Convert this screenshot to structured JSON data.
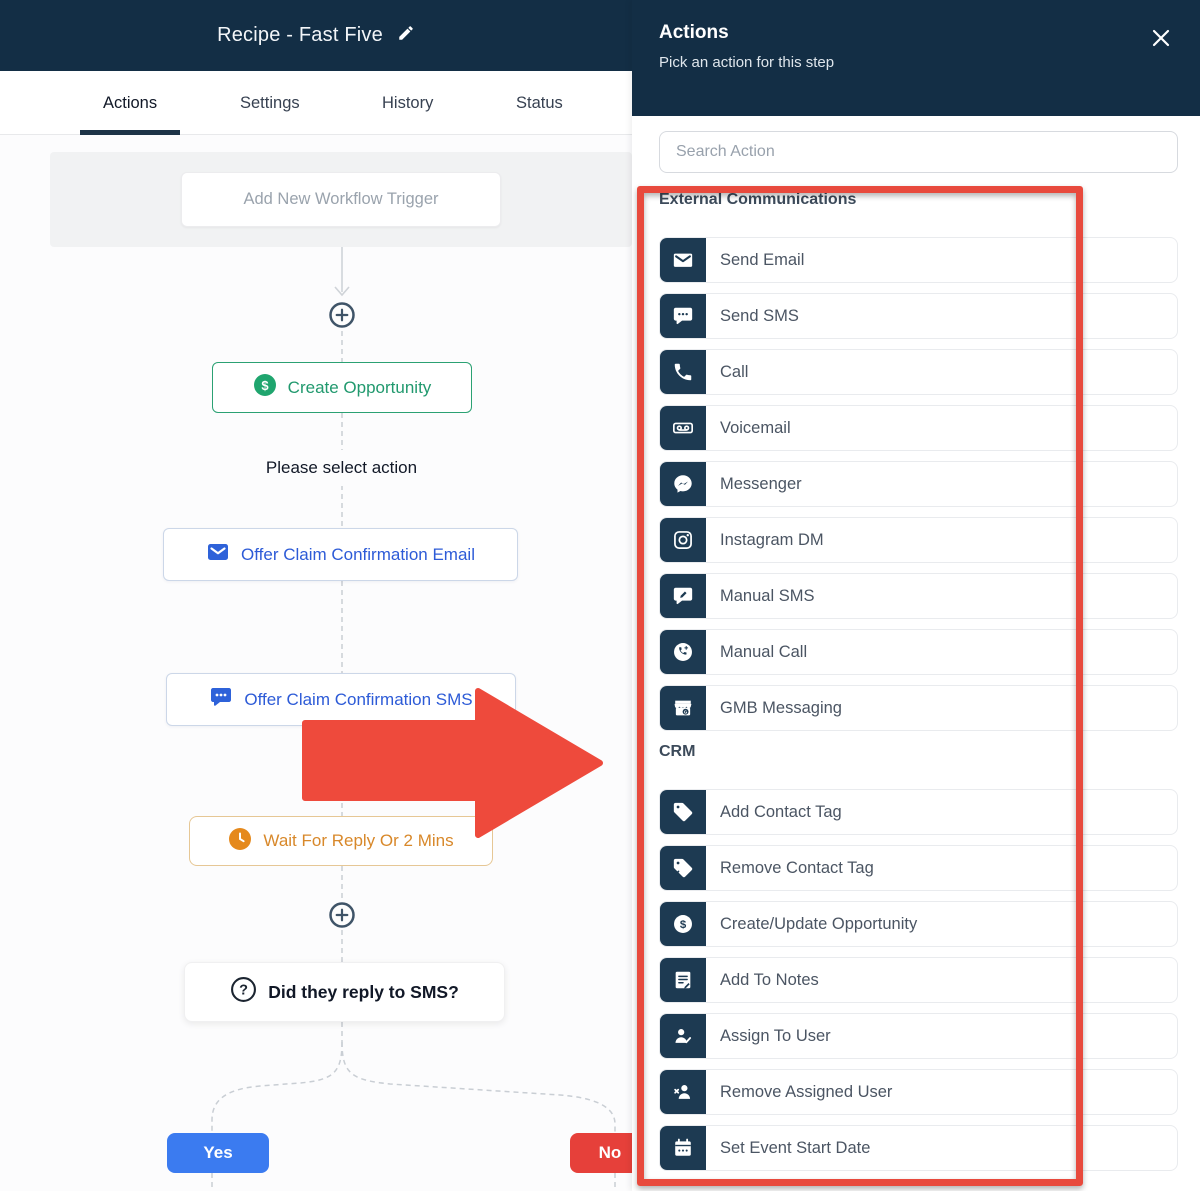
{
  "header": {
    "title": "Recipe - Fast Five",
    "edit_icon": "edit-pencil-icon"
  },
  "tabs": [
    {
      "label": "Actions",
      "active": true
    },
    {
      "label": "Settings",
      "active": false
    },
    {
      "label": "History",
      "active": false
    },
    {
      "label": "Status",
      "active": false
    }
  ],
  "canvas": {
    "trigger_label": "Add New Workflow Trigger",
    "create_opportunity_label": "Create Opportunity",
    "please_select_label": "Please select action",
    "email_action_label": "Offer Claim Confirmation Email",
    "sms_action_label": "Offer Claim Confirmation SMS",
    "wait_label": "Wait For Reply Or 2 Mins",
    "question_label": "Did they reply to SMS?",
    "branch_yes": "Yes",
    "branch_no": "No",
    "plus_icon": "plus-icon",
    "node_icons": [
      "opportunity-dollar-icon",
      "email-icon",
      "sms-icon",
      "clock-icon",
      "question-icon"
    ]
  },
  "panel": {
    "title": "Actions",
    "subtitle": "Pick an action for this step",
    "close_icon": "close-icon",
    "search_placeholder": "Search Action",
    "sections": [
      {
        "title": "External Communications",
        "items": [
          {
            "icon": "send-email-icon",
            "label": "Send Email"
          },
          {
            "icon": "send-sms-icon",
            "label": "Send SMS"
          },
          {
            "icon": "call-icon",
            "label": "Call"
          },
          {
            "icon": "voicemail-icon",
            "label": "Voicemail"
          },
          {
            "icon": "messenger-icon",
            "label": "Messenger"
          },
          {
            "icon": "instagram-dm-icon",
            "label": "Instagram DM"
          },
          {
            "icon": "manual-sms-icon",
            "label": "Manual SMS"
          },
          {
            "icon": "manual-call-icon",
            "label": "Manual Call"
          },
          {
            "icon": "gmb-messaging-icon",
            "label": "GMB Messaging"
          }
        ]
      },
      {
        "title": "CRM",
        "items": [
          {
            "icon": "add-contact-tag-icon",
            "label": "Add Contact Tag"
          },
          {
            "icon": "remove-contact-tag-icon",
            "label": "Remove Contact Tag"
          },
          {
            "icon": "create-update-opportunity-icon",
            "label": "Create/Update Opportunity"
          },
          {
            "icon": "add-to-notes-icon",
            "label": "Add To Notes"
          },
          {
            "icon": "assign-to-user-icon",
            "label": "Assign To User"
          },
          {
            "icon": "remove-assigned-user-icon",
            "label": "Remove Assigned User"
          },
          {
            "icon": "set-event-start-date-icon",
            "label": "Set Event Start Date"
          }
        ]
      }
    ]
  },
  "colors": {
    "header_navy": "#132e45",
    "icon_navy": "#1d3a52",
    "highlight_red": "#e84a3d",
    "arrow_red": "#ee4a3c",
    "action_blue": "#2d5bd7",
    "opportunity_green": "#21996e",
    "wait_orange": "#d8882a",
    "yes_blue": "#3b7bf0",
    "no_red": "#e6403a"
  }
}
